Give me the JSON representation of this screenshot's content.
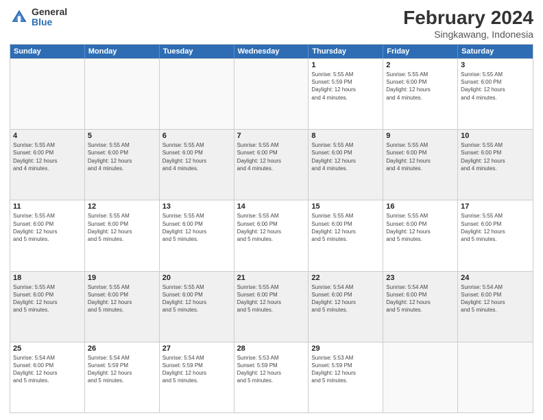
{
  "header": {
    "logo": {
      "general": "General",
      "blue": "Blue"
    },
    "title": "February 2024",
    "subtitle": "Singkawang, Indonesia"
  },
  "days_of_week": [
    "Sunday",
    "Monday",
    "Tuesday",
    "Wednesday",
    "Thursday",
    "Friday",
    "Saturday"
  ],
  "rows": [
    {
      "shaded": false,
      "cells": [
        {
          "empty": true,
          "day": "",
          "info": ""
        },
        {
          "empty": true,
          "day": "",
          "info": ""
        },
        {
          "empty": true,
          "day": "",
          "info": ""
        },
        {
          "empty": true,
          "day": "",
          "info": ""
        },
        {
          "empty": false,
          "day": "1",
          "info": "Sunrise: 5:55 AM\nSunset: 5:59 PM\nDaylight: 12 hours\nand 4 minutes."
        },
        {
          "empty": false,
          "day": "2",
          "info": "Sunrise: 5:55 AM\nSunset: 6:00 PM\nDaylight: 12 hours\nand 4 minutes."
        },
        {
          "empty": false,
          "day": "3",
          "info": "Sunrise: 5:55 AM\nSunset: 6:00 PM\nDaylight: 12 hours\nand 4 minutes."
        }
      ]
    },
    {
      "shaded": true,
      "cells": [
        {
          "empty": false,
          "day": "4",
          "info": "Sunrise: 5:55 AM\nSunset: 6:00 PM\nDaylight: 12 hours\nand 4 minutes."
        },
        {
          "empty": false,
          "day": "5",
          "info": "Sunrise: 5:55 AM\nSunset: 6:00 PM\nDaylight: 12 hours\nand 4 minutes."
        },
        {
          "empty": false,
          "day": "6",
          "info": "Sunrise: 5:55 AM\nSunset: 6:00 PM\nDaylight: 12 hours\nand 4 minutes."
        },
        {
          "empty": false,
          "day": "7",
          "info": "Sunrise: 5:55 AM\nSunset: 6:00 PM\nDaylight: 12 hours\nand 4 minutes."
        },
        {
          "empty": false,
          "day": "8",
          "info": "Sunrise: 5:55 AM\nSunset: 6:00 PM\nDaylight: 12 hours\nand 4 minutes."
        },
        {
          "empty": false,
          "day": "9",
          "info": "Sunrise: 5:55 AM\nSunset: 6:00 PM\nDaylight: 12 hours\nand 4 minutes."
        },
        {
          "empty": false,
          "day": "10",
          "info": "Sunrise: 5:55 AM\nSunset: 6:00 PM\nDaylight: 12 hours\nand 4 minutes."
        }
      ]
    },
    {
      "shaded": false,
      "cells": [
        {
          "empty": false,
          "day": "11",
          "info": "Sunrise: 5:55 AM\nSunset: 6:00 PM\nDaylight: 12 hours\nand 5 minutes."
        },
        {
          "empty": false,
          "day": "12",
          "info": "Sunrise: 5:55 AM\nSunset: 6:00 PM\nDaylight: 12 hours\nand 5 minutes."
        },
        {
          "empty": false,
          "day": "13",
          "info": "Sunrise: 5:55 AM\nSunset: 6:00 PM\nDaylight: 12 hours\nand 5 minutes."
        },
        {
          "empty": false,
          "day": "14",
          "info": "Sunrise: 5:55 AM\nSunset: 6:00 PM\nDaylight: 12 hours\nand 5 minutes."
        },
        {
          "empty": false,
          "day": "15",
          "info": "Sunrise: 5:55 AM\nSunset: 6:00 PM\nDaylight: 12 hours\nand 5 minutes."
        },
        {
          "empty": false,
          "day": "16",
          "info": "Sunrise: 5:55 AM\nSunset: 6:00 PM\nDaylight: 12 hours\nand 5 minutes."
        },
        {
          "empty": false,
          "day": "17",
          "info": "Sunrise: 5:55 AM\nSunset: 6:00 PM\nDaylight: 12 hours\nand 5 minutes."
        }
      ]
    },
    {
      "shaded": true,
      "cells": [
        {
          "empty": false,
          "day": "18",
          "info": "Sunrise: 5:55 AM\nSunset: 6:00 PM\nDaylight: 12 hours\nand 5 minutes."
        },
        {
          "empty": false,
          "day": "19",
          "info": "Sunrise: 5:55 AM\nSunset: 6:00 PM\nDaylight: 12 hours\nand 5 minutes."
        },
        {
          "empty": false,
          "day": "20",
          "info": "Sunrise: 5:55 AM\nSunset: 6:00 PM\nDaylight: 12 hours\nand 5 minutes."
        },
        {
          "empty": false,
          "day": "21",
          "info": "Sunrise: 5:55 AM\nSunset: 6:00 PM\nDaylight: 12 hours\nand 5 minutes."
        },
        {
          "empty": false,
          "day": "22",
          "info": "Sunrise: 5:54 AM\nSunset: 6:00 PM\nDaylight: 12 hours\nand 5 minutes."
        },
        {
          "empty": false,
          "day": "23",
          "info": "Sunrise: 5:54 AM\nSunset: 6:00 PM\nDaylight: 12 hours\nand 5 minutes."
        },
        {
          "empty": false,
          "day": "24",
          "info": "Sunrise: 5:54 AM\nSunset: 6:00 PM\nDaylight: 12 hours\nand 5 minutes."
        }
      ]
    },
    {
      "shaded": false,
      "cells": [
        {
          "empty": false,
          "day": "25",
          "info": "Sunrise: 5:54 AM\nSunset: 6:00 PM\nDaylight: 12 hours\nand 5 minutes."
        },
        {
          "empty": false,
          "day": "26",
          "info": "Sunrise: 5:54 AM\nSunset: 5:59 PM\nDaylight: 12 hours\nand 5 minutes."
        },
        {
          "empty": false,
          "day": "27",
          "info": "Sunrise: 5:54 AM\nSunset: 5:59 PM\nDaylight: 12 hours\nand 5 minutes."
        },
        {
          "empty": false,
          "day": "28",
          "info": "Sunrise: 5:53 AM\nSunset: 5:59 PM\nDaylight: 12 hours\nand 5 minutes."
        },
        {
          "empty": false,
          "day": "29",
          "info": "Sunrise: 5:53 AM\nSunset: 5:59 PM\nDaylight: 12 hours\nand 5 minutes."
        },
        {
          "empty": true,
          "day": "",
          "info": ""
        },
        {
          "empty": true,
          "day": "",
          "info": ""
        }
      ]
    }
  ]
}
